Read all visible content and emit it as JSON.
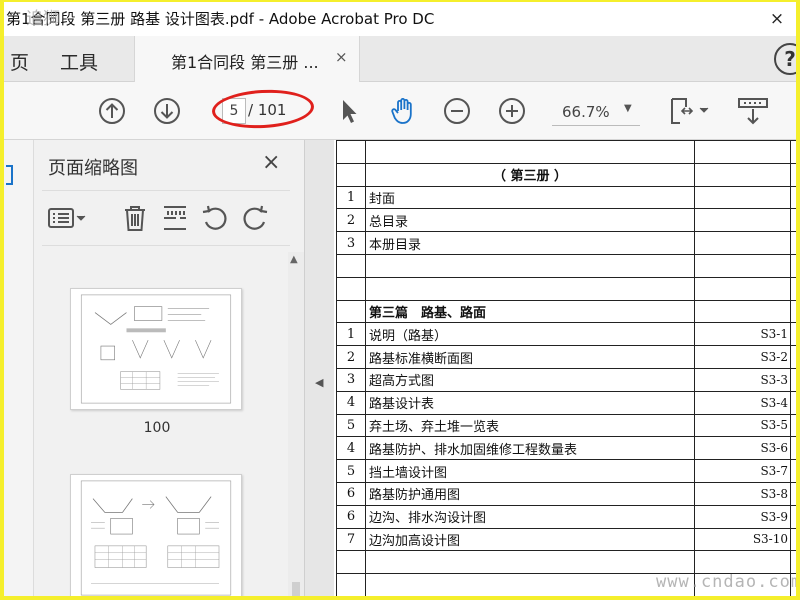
{
  "window": {
    "title": "第1合同段 第三册 路基 设计图表.pdf - Adobe Acrobat Pro DC",
    "watermark": "追狮",
    "close_symbol": "×"
  },
  "tabs": {
    "home_partial": "页",
    "tools": "工具",
    "document": "第1合同段 第三册 ...",
    "close_symbol": "×",
    "help_symbol": "?"
  },
  "toolbar": {
    "page_current": "5",
    "page_total": "/ 101",
    "zoom": "66.7%",
    "zoom_caret": "▼"
  },
  "thumbnail_panel": {
    "title": "页面缩略图",
    "close_symbol": "×",
    "page_label_1": "100",
    "scroll_up": "▲"
  },
  "splitter": {
    "arrow": "◀"
  },
  "document": {
    "volume_heading": "（ 第三册 ）",
    "section_heading": "第三篇　路基、路面",
    "rows_front": [
      {
        "num": "1",
        "name": "封面",
        "code": ""
      },
      {
        "num": "2",
        "name": "总目录",
        "code": ""
      },
      {
        "num": "3",
        "name": "本册目录",
        "code": ""
      }
    ],
    "rows_section": [
      {
        "num": "1",
        "name": "说明（路基）",
        "code": "S3-1"
      },
      {
        "num": "2",
        "name": "路基标准横断面图",
        "code": "S3-2"
      },
      {
        "num": "3",
        "name": "超高方式图",
        "code": "S3-3"
      },
      {
        "num": "4",
        "name": "路基设计表",
        "code": "S3-4"
      },
      {
        "num": "5",
        "name": "弃土场、弃土堆一览表",
        "code": "S3-5"
      },
      {
        "num": "4",
        "name": "路基防护、排水加固维修工程数量表",
        "code": "S3-6"
      },
      {
        "num": "5",
        "name": "挡土墙设计图",
        "code": "S3-7"
      },
      {
        "num": "6",
        "name": "路基防护通用图",
        "code": "S3-8"
      },
      {
        "num": "6",
        "name": "边沟、排水沟设计图",
        "code": "S3-9"
      },
      {
        "num": "7",
        "name": "边沟加高设计图",
        "code": "S3-10"
      }
    ],
    "site_watermark": "www.cndao.com"
  },
  "colors": {
    "frame": "#f5ef2c",
    "annotation": "#e0201c",
    "hand_tool": "#1a73c9"
  },
  "icons": [
    "arrow-up-circle-icon",
    "arrow-down-circle-icon",
    "select-cursor-icon",
    "hand-tool-icon",
    "zoom-out-icon",
    "zoom-in-icon",
    "fit-page-icon",
    "scroll-mode-icon"
  ]
}
